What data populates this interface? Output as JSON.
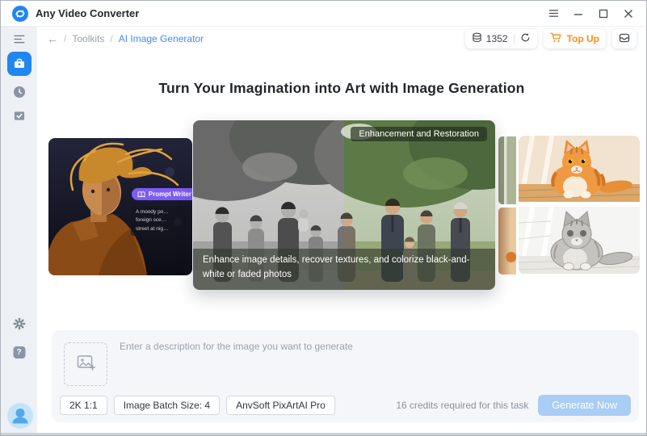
{
  "titlebar": {
    "app_title": "Any Video Converter"
  },
  "nav": {
    "separator": "/",
    "toolkits": "Toolkits",
    "current": "AI Image Generator"
  },
  "wallet": {
    "credits": "1352",
    "top_up_label": "Top Up"
  },
  "page": {
    "heading": "Turn Your Imagination into Art with Image Generation"
  },
  "carousel": {
    "left_card": {
      "pill_label": "Prompt Writer",
      "prompt_lines": [
        "A moody po…",
        "foreign sce…",
        "street at nig…"
      ]
    },
    "center_card": {
      "badge": "Enhancement and Restoration",
      "caption": "Enhance image details, recover textures, and colorize black-and-white or faded photos"
    }
  },
  "composer": {
    "placeholder": "Enter a description for the image you want to generate",
    "chips": [
      {
        "label": "2K 1:1"
      },
      {
        "label": "Image Batch Size: 4"
      },
      {
        "label": "AnvSoft PixArtAI Pro"
      }
    ],
    "credits_note": "16 credits required for this task",
    "generate_label": "Generate Now"
  },
  "icons": {
    "back": "←",
    "help": "?"
  },
  "colors": {
    "accent": "#2086f2",
    "link": "#3f8cf3",
    "orange": "#ff8c1a",
    "generate_disabled": "#a9cdf4",
    "sidebar_bg": "#edf0f4"
  }
}
